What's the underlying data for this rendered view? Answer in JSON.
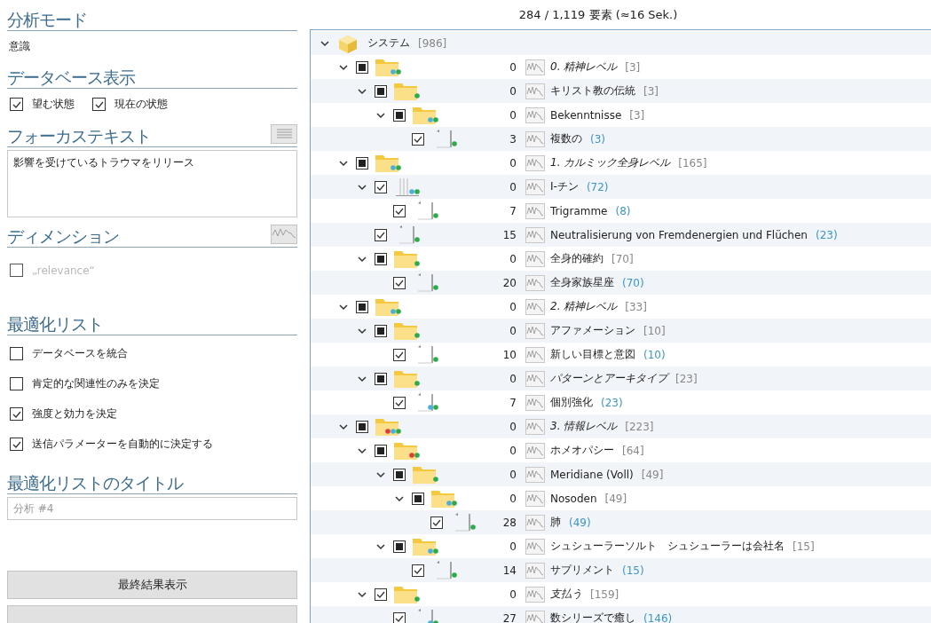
{
  "left_panel": {
    "analysis_mode": {
      "heading": "分析モード",
      "value": "意識"
    },
    "database_view": {
      "heading": "データベース表示",
      "options": [
        {
          "label": "望む状態",
          "checked": true
        },
        {
          "label": "現在の状態",
          "checked": true
        }
      ]
    },
    "focus_text": {
      "heading": "フォーカステキスト",
      "value": "影響を受けているトラウマをリリース"
    },
    "dimension": {
      "heading": "ディメンション",
      "options": [
        {
          "label": "„relevance“",
          "checked": false,
          "disabled": true
        }
      ]
    },
    "optimization_list": {
      "heading": "最適化リスト",
      "options": [
        {
          "label": "データベースを統合",
          "checked": false
        },
        {
          "label": "肯定的な関連性のみを決定",
          "checked": false
        },
        {
          "label": "強度と効力を決定",
          "checked": true
        },
        {
          "label": "送信パラメーターを自動的に決定する",
          "checked": true
        }
      ]
    },
    "list_title": {
      "heading": "最適化リストのタイトル",
      "placeholder": "分析 #4"
    },
    "buttons": [
      {
        "kind": "labeled",
        "label": "最終結果表示"
      },
      {
        "kind": "cut"
      }
    ]
  },
  "status": "284 / 1,119 要素 (≈16 Sek.)",
  "tree": {
    "root": {
      "name": "システム",
      "total": "[986]",
      "expanded": true
    },
    "children": [
      {
        "kind": "folder",
        "mixed": true,
        "expanded": true,
        "dots": [
          {
            "color": "#4ab0d9"
          },
          {
            "color": "#2faa4a"
          }
        ],
        "count": "0",
        "name": "0. 精神レベル",
        "italic": true,
        "total": "[3]",
        "children": [
          {
            "kind": "folder",
            "mixed": true,
            "expanded": true,
            "dots": [
              {
                "color": "#2faa4a"
              }
            ],
            "count": "0",
            "name": "キリスト教の伝統",
            "italic": false,
            "total": "[3]",
            "children": [
              {
                "kind": "folder",
                "mixed": true,
                "expanded": true,
                "dots": [
                  {
                    "color": "#4ab0d9"
                  },
                  {
                    "color": "#2faa4a"
                  }
                ],
                "count": "0",
                "name": "Bekenntnisse",
                "italic": false,
                "total": "[3]",
                "children": [
                  {
                    "kind": "document",
                    "checked": true,
                    "dots": [
                      {
                        "color": "#2faa4a"
                      }
                    ],
                    "count": "3",
                    "name": "複数の",
                    "italic": false,
                    "total": "(3)"
                  }
                ]
              }
            ]
          }
        ]
      },
      {
        "kind": "folder",
        "mixed": true,
        "expanded": true,
        "dots": [
          {
            "color": "#4ab0d9"
          },
          {
            "color": "#2faa4a"
          }
        ],
        "count": "0",
        "name": "1. カルミック全身レベル",
        "italic": true,
        "total": "[165]",
        "children": [
          {
            "kind": "stack",
            "checked": true,
            "expanded": true,
            "dots": [
              {
                "color": "#4ab0d9"
              },
              {
                "color": "#2faa4a"
              }
            ],
            "count": "0",
            "name": "I-チン",
            "italic": false,
            "total": "(72)",
            "children": [
              {
                "kind": "document",
                "checked": true,
                "dots": [
                  {
                    "color": "#2faa4a"
                  }
                ],
                "count": "7",
                "name": "Trigramme",
                "italic": false,
                "total": "(8)"
              }
            ]
          },
          {
            "kind": "document",
            "checked": true,
            "dots": [
              {
                "color": "#2faa4a"
              }
            ],
            "count": "15",
            "name": "Neutralisierung von Fremdenergien und Flüchen",
            "italic": false,
            "total": "(23)"
          },
          {
            "kind": "folder",
            "mixed": true,
            "expanded": true,
            "dots": [
              {
                "color": "#2faa4a"
              }
            ],
            "count": "0",
            "name": "全身的確約",
            "italic": false,
            "total": "[70]",
            "children": [
              {
                "kind": "document",
                "checked": true,
                "dots": [
                  {
                    "color": "#2faa4a"
                  }
                ],
                "count": "20",
                "name": "全身家族星座",
                "italic": false,
                "total": "(70)"
              }
            ]
          }
        ]
      },
      {
        "kind": "folder",
        "mixed": true,
        "expanded": true,
        "dots": [
          {
            "color": "#4ab0d9"
          },
          {
            "color": "#2faa4a"
          }
        ],
        "count": "0",
        "name": "2. 精神レベル",
        "italic": true,
        "total": "[33]",
        "children": [
          {
            "kind": "folder",
            "mixed": true,
            "expanded": true,
            "dots": [
              {
                "color": "#2faa4a"
              }
            ],
            "count": "0",
            "name": "アファメーション",
            "italic": false,
            "total": "[10]",
            "children": [
              {
                "kind": "document",
                "checked": true,
                "dots": [
                  {
                    "color": "#2faa4a"
                  }
                ],
                "count": "10",
                "name": "新しい目標と意図",
                "italic": false,
                "total": "(10)"
              }
            ]
          },
          {
            "kind": "folder",
            "mixed": true,
            "expanded": true,
            "dots": [
              {
                "color": "#2faa4a"
              }
            ],
            "count": "0",
            "name": "パターンとアーキタイプ",
            "italic": true,
            "total": "[23]",
            "children": [
              {
                "kind": "document",
                "checked": true,
                "dots": [
                  {
                    "color": "#4ab0d9"
                  },
                  {
                    "color": "#2faa4a"
                  }
                ],
                "count": "7",
                "name": "個別強化",
                "italic": false,
                "total": "(23)"
              }
            ]
          }
        ]
      },
      {
        "kind": "folder",
        "mixed": true,
        "expanded": true,
        "dots": [
          {
            "color": "#e53935"
          },
          {
            "color": "#4ab0d9"
          },
          {
            "color": "#2faa4a"
          }
        ],
        "count": "0",
        "name": "3. 情報レベル",
        "italic": true,
        "total": "[223]",
        "children": [
          {
            "kind": "folder",
            "mixed": true,
            "expanded": true,
            "dots": [
              {
                "color": "#e53935"
              },
              {
                "color": "#2faa4a"
              }
            ],
            "count": "0",
            "name": "ホメオパシー",
            "italic": false,
            "total": "[64]",
            "children": [
              {
                "kind": "folder",
                "mixed": true,
                "expanded": true,
                "dots": [
                  {
                    "color": "#2faa4a"
                  }
                ],
                "count": "0",
                "name": "Meridiane (Voll)",
                "italic": false,
                "total": "[49]",
                "children": [
                  {
                    "kind": "folder",
                    "mixed": true,
                    "expanded": true,
                    "dots": [
                      {
                        "color": "#4ab0d9"
                      },
                      {
                        "color": "#2faa4a"
                      }
                    ],
                    "count": "0",
                    "name": "Nosoden",
                    "italic": false,
                    "total": "[49]",
                    "children": [
                      {
                        "kind": "document",
                        "checked": true,
                        "dots": [
                          {
                            "color": "#2faa4a"
                          }
                        ],
                        "count": "28",
                        "name": "肺",
                        "italic": false,
                        "total": "(49)"
                      }
                    ]
                  }
                ]
              },
              {
                "kind": "folder",
                "mixed": true,
                "expanded": true,
                "dots": [
                  {
                    "color": "#4ab0d9"
                  },
                  {
                    "color": "#2faa4a"
                  }
                ],
                "count": "0",
                "name": "シュシューラーソルト　シュシューラーは会社名",
                "italic": false,
                "total": "[15]",
                "children": [
                  {
                    "kind": "document",
                    "checked": true,
                    "dots": [
                      {
                        "color": "#2faa4a"
                      }
                    ],
                    "count": "14",
                    "name": "サプリメント",
                    "italic": false,
                    "total": "(15)"
                  }
                ]
              }
            ]
          },
          {
            "kind": "folder",
            "checked": true,
            "expanded": true,
            "dots": [
              {
                "color": "#2faa4a"
              }
            ],
            "count": "0",
            "name": "支払う",
            "italic": true,
            "total": "[159]",
            "children": [
              {
                "kind": "document",
                "checked": true,
                "dots": [
                  {
                    "color": "#4ab0d9"
                  },
                  {
                    "color": "#2faa4a"
                  }
                ],
                "count": "27",
                "name": "数シリーズで癒し",
                "italic": false,
                "total": "(146)"
              }
            ]
          }
        ]
      }
    ]
  }
}
